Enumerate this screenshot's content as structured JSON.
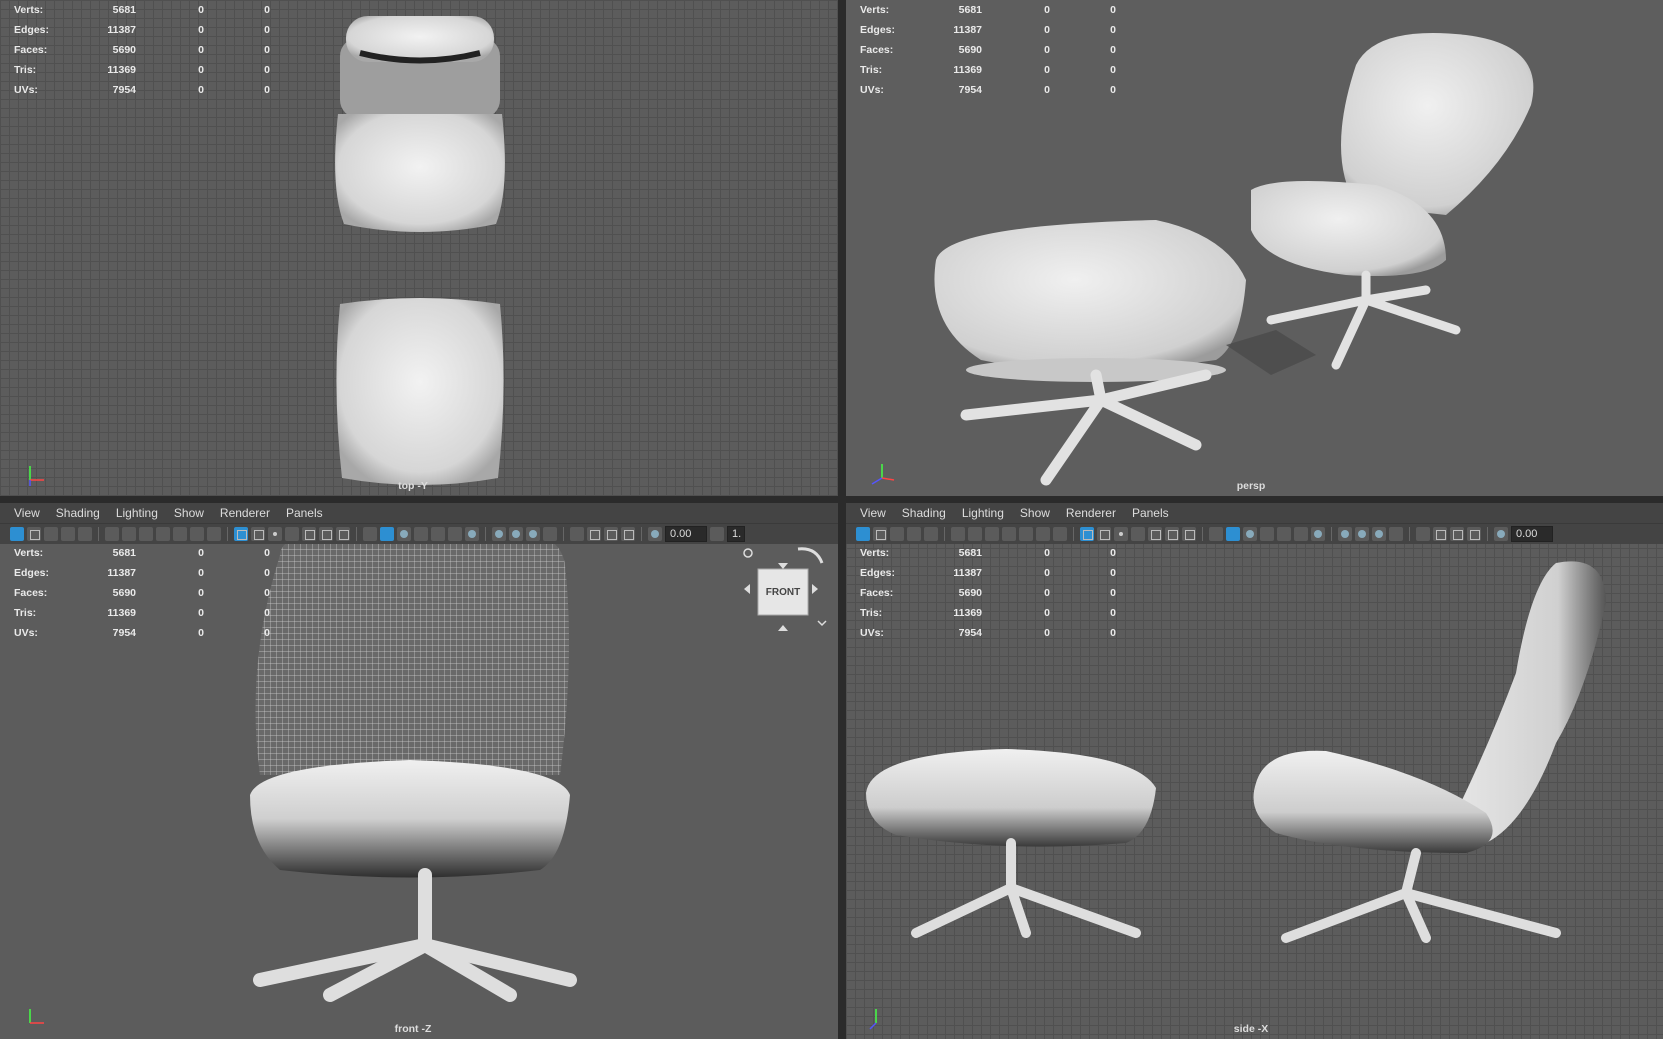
{
  "menu": [
    "View",
    "Shading",
    "Lighting",
    "Show",
    "Renderer",
    "Panels"
  ],
  "toolbar": {
    "field_value": "0.00",
    "field_value_trunc": "1."
  },
  "stats": {
    "rows": [
      {
        "label": "Verts:",
        "v1": "5681",
        "v2": "0",
        "v3": "0"
      },
      {
        "label": "Edges:",
        "v1": "11387",
        "v2": "0",
        "v3": "0"
      },
      {
        "label": "Faces:",
        "v1": "5690",
        "v2": "0",
        "v3": "0"
      },
      {
        "label": "Tris:",
        "v1": "11369",
        "v2": "0",
        "v3": "0"
      },
      {
        "label": "UVs:",
        "v1": "7954",
        "v2": "0",
        "v3": "0"
      }
    ]
  },
  "viewports": {
    "top": {
      "camera": "top -Y"
    },
    "persp": {
      "camera": "persp"
    },
    "front": {
      "camera": "front -Z"
    },
    "side": {
      "camera": "side -X"
    }
  },
  "viewcube": {
    "label": "FRONT"
  },
  "axis": {
    "x": "x",
    "y": "y",
    "z": "z"
  },
  "colors": {
    "viewport_bg": "#5c5c5c",
    "toolbar_bg": "#444444",
    "accent": "#2d8fd2",
    "model": "#d9d9d9"
  }
}
